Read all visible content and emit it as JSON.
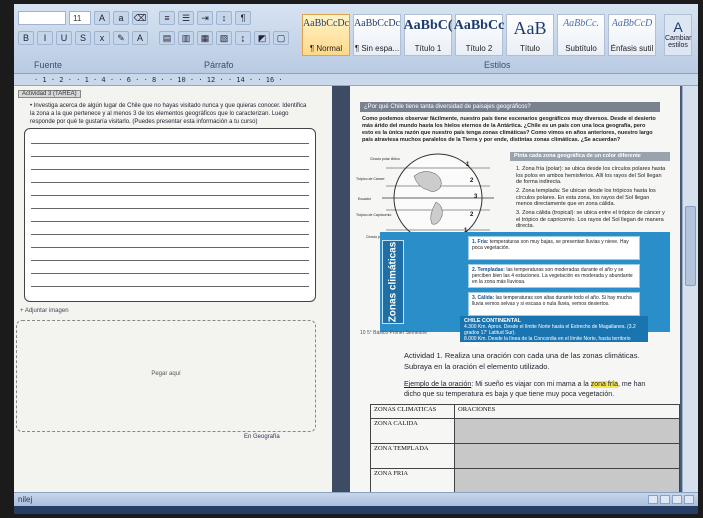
{
  "ribbon": {
    "font_size": "11",
    "groups": {
      "font": "Fuente",
      "paragraph": "Párrafo",
      "styles": "Estilos"
    },
    "styles": [
      {
        "sample": "AaBbCcDc",
        "name": "¶ Normal",
        "active": true
      },
      {
        "sample": "AaBbCcDc",
        "name": "¶ Sin espa...",
        "active": false
      },
      {
        "sample": "AaBbC(",
        "name": "Título 1",
        "active": false
      },
      {
        "sample": "AaBbCc",
        "name": "Título 2",
        "active": false
      },
      {
        "sample": "AaB",
        "name": "Título",
        "active": false
      },
      {
        "sample": "AaBbCc.",
        "name": "Subtítulo",
        "active": false
      },
      {
        "sample": "AaBbCcD",
        "name": "Énfasis sutil",
        "active": false
      }
    ],
    "change_styles": "Cambiar estilos"
  },
  "ruler": {
    "text": "· 1 · 2 · · 1 · 4 · · 6 · · 8 · · 10 · · 12 · · 14 · · 16 ·"
  },
  "left_page": {
    "tag": "Actividad 3 (TAREA)",
    "instruction": "• Investiga acerca de algún lugar de Chile que no hayas visitado nunca y que quieras conocer. Identifica la zona a la que pertenece y al menos 3 de los elementos geográficos que lo caracterizan. Luego responde por qué te gustaría visitarlo. (Puedes presentar esta información a tu curso)",
    "attach_label": "+ Adjuntar imagen",
    "paste_label": "Pegar aquí",
    "footer": "En Geografía"
  },
  "right_page": {
    "banner": "¿Por qué Chile tiene tanta diversidad de paisajes geográficos?",
    "intro": "Como podemos observar fácilmente, nuestro país tiene escenarios geográficos muy diversos. Desde el desierto más árido del mundo hasta los hielos eternos de la Antártica. ¿Chile es un país con una loca geografía, pero esto es la única razón que nuestro país tenga zonas climáticas? Como vimos en años anteriores, nuestro largo país atraviesa muchos paralelos de la Tierra y por ende, distintas zonas climáticas. ¿Se acuerdan?",
    "globe_labels": [
      "Círculo polar Ártico",
      "Trópico de Cáncer",
      "Ecuador",
      "Trópico de Capricornio",
      "Círculo polar Antártico"
    ],
    "globe_numbers": [
      "1",
      "2",
      "3",
      "2",
      "1"
    ],
    "zones_title": "Pinta cada zona geográfica de un color diferente",
    "zones": [
      "1. Zona fría (polar): se ubica desde los círculos polares hasta los polos en ambos hemisferios. Allí los rayos del Sol llegan de forma indirecta.",
      "2. Zona templada: Se ubican desde los trópicos hasta los círculos polares. En esta zona, los rayos del Sol llegan menos directamente que en zona cálida.",
      "3. Zona cálida (tropical): se ubica entre el trópico de cáncer y el trópico de capricornio. Los rayos del Sol llegan de manera directa."
    ],
    "climas_title": "Zonas climáticas",
    "climas": [
      {
        "name": "1. Fría:",
        "text": "temperaturas son muy bajas, se presentan lluvias y nieve. Hay poca vegetación."
      },
      {
        "name": "2. Templadas:",
        "text": "las temperaturas son moderadas durante el año y se perciben bien las 4 estaciones. La vegetación es moderada y abundante en la zona más lluviosa."
      },
      {
        "name": "3. Cálida:",
        "text": "las temperaturas son altas durante todo el año. Si hay mucha lluvia vemos selvas y si escasa o nula lluvia, vemos desiertos."
      }
    ],
    "chile_card": {
      "title": "CHILE CONTINENTAL",
      "lines": [
        "4.300 Km. Aprox. Desde el límite Norte hasta el Estrecho de Magallanes. (3.2 grados 17' Latitud Sur).",
        "8.000 Km. Desde la línea de la Concordia en el límite Norte, hasta territorio Antártico."
      ]
    },
    "page_number": "10    5° Básico Primer Semestre",
    "activity": "Actividad 1. Realiza una oración con cada una de las zonas climáticas. Subraya en la oración el elemento utilizado.",
    "example_label": "Ejemplo de la oración",
    "example_before": ": Mi sueño es viajar con mi mama a la ",
    "example_highlight": "zona fría",
    "example_after": ", me han dicho que su temperatura es baja y que tiene muy poca vegetación.",
    "table": {
      "headers": [
        "ZONAS CLIMATICAS",
        "ORACIONES"
      ],
      "rows": [
        "ZONA CALIDA",
        "ZONA TEMPLADA",
        "ZONA FRIA"
      ]
    }
  },
  "status_bar": {
    "text": "nilej"
  }
}
